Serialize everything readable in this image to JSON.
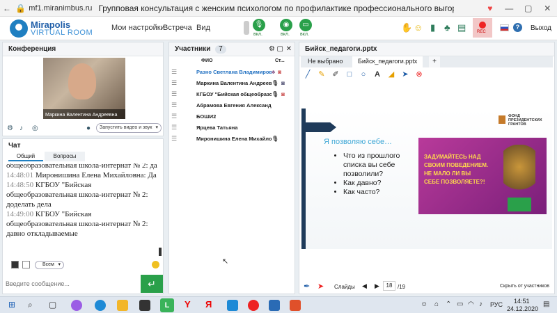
{
  "browser": {
    "url": "mf1.miranimbus.ru",
    "title": "Групповая консультация с женским психологом по профилактике профессионального выгорания для педаг..."
  },
  "header": {
    "brand_top": "Mirapolis",
    "brand_bottom": "VIRTUAL ROOM",
    "menu": [
      "Мои настройки",
      "Встреча",
      "Вид"
    ],
    "mic_label": "вкл.",
    "cam_label": "вкл.",
    "screen_label": "вкл.",
    "rec_label": "REC",
    "exit_label": "Выход",
    "help_label": "?"
  },
  "conference": {
    "title": "Конференция",
    "video_name": "Маркина Валентина Андреевна",
    "start_video_button": "Запустить видео и звук"
  },
  "chat": {
    "title": "Чат",
    "tabs": [
      "Общий",
      "Вопросы"
    ],
    "messages": [
      {
        "time": "",
        "author": "",
        "text": "общеобразовательная школа-интернат № 2: да"
      },
      {
        "time": "14:48:01",
        "author": "Миронишина Елена Михайловна",
        "text": "Да"
      },
      {
        "time": "14:48:50",
        "author": "КГБОУ \"Бийская общеобразовательная школа-интернат № 2",
        "text": "доделать дела"
      },
      {
        "time": "14:49:00",
        "author": "КГБОУ \"Бийская общеобразовательная школа-интернат № 2",
        "text": "давно откладываемые"
      }
    ],
    "recipient": "Всем",
    "input_placeholder": "Введите сообщение..."
  },
  "participants": {
    "title": "Участники",
    "count": "7",
    "col_name": "ФИО",
    "col_status": "Ст...",
    "rows": [
      "Разно Светлана Владимировна",
      "Маркина Валентина Андреевна",
      "КГБОУ \"Бийская общеобразо...",
      "Абрамова Евгения Александ...",
      "БОШИ2",
      "Ярцева Татьяна",
      "Миронишина Елена Михайло..."
    ]
  },
  "presentation": {
    "title": "Бийск_педагоги.pptx",
    "tabs": [
      "Не выбрано",
      "Бийск_педагоги.pptx",
      "+"
    ],
    "slide_heading": "Я позволяю себе…",
    "bullets": [
      "Что из прошлого списка вы себе позволили?",
      "Как давно?",
      "Как часто?"
    ],
    "fund_text": "ФОНД ПРЕЗИДЕНТСКИХ ГРАНТОВ",
    "poster_lines": [
      "ЗАДУМАЙТЕСЬ НАД",
      "СВОИМ ПОВЕДЕНИЕМ.",
      "НЕ МАЛО ЛИ ВЫ",
      "СЕБЕ ПОЗВОЛЯЕТЕ?!"
    ],
    "slides_label": "Слайды",
    "current_slide": "18",
    "total_slides": "/19",
    "hide_label": "Скрыть от участников"
  },
  "taskbar": {
    "lang": "РУС",
    "time": "14:51",
    "date": "24.12.2020"
  }
}
